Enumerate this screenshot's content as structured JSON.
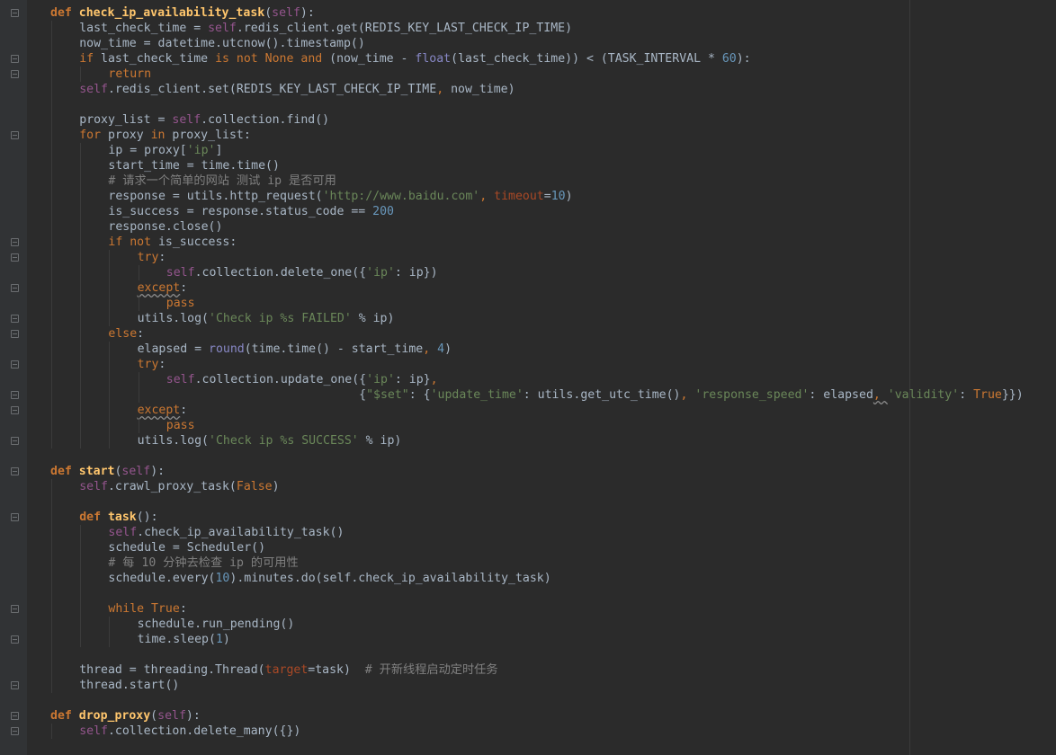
{
  "editor": {
    "theme_colors": {
      "background": "#2b2b2b",
      "keyword": "#cc7832",
      "function_name": "#ffc66d",
      "self": "#94558d",
      "string": "#6a8759",
      "number": "#6897bb",
      "comment": "#808080",
      "builtin": "#8888c6",
      "default_text": "#a9b7c6"
    },
    "lines": [
      {
        "fold": true,
        "indent": 0,
        "tokens": [
          [
            "kw",
            "def "
          ],
          [
            "fn",
            "check_ip_availability_task"
          ],
          [
            "op",
            "("
          ],
          [
            "self",
            "self"
          ],
          [
            "op",
            "):"
          ]
        ]
      },
      {
        "fold": false,
        "indent": 1,
        "tokens": [
          [
            "op",
            "last_check_time = "
          ],
          [
            "self",
            "self"
          ],
          [
            "op",
            ".redis_client.get(REDIS_KEY_LAST_CHECK_IP_TIME)"
          ]
        ]
      },
      {
        "fold": false,
        "indent": 1,
        "tokens": [
          [
            "op",
            "now_time = datetime.utcnow().timestamp()"
          ]
        ]
      },
      {
        "fold": true,
        "indent": 1,
        "tokens": [
          [
            "kwn",
            "if"
          ],
          [
            "op",
            " last_check_time "
          ],
          [
            "kwn",
            "is not"
          ],
          [
            "op",
            " "
          ],
          [
            "kwn",
            "None"
          ],
          [
            "op",
            " "
          ],
          [
            "kwn",
            "and"
          ],
          [
            "op",
            " (now_time - "
          ],
          [
            "bi",
            "float"
          ],
          [
            "op",
            "(last_check_time)) < (TASK_INTERVAL * "
          ],
          [
            "num",
            "60"
          ],
          [
            "op",
            "):"
          ]
        ]
      },
      {
        "fold": true,
        "indent": 2,
        "tokens": [
          [
            "kwn",
            "return"
          ]
        ]
      },
      {
        "fold": false,
        "indent": 1,
        "tokens": [
          [
            "self",
            "self"
          ],
          [
            "op",
            ".redis_client.set(REDIS_KEY_LAST_CHECK_IP_TIME"
          ],
          [
            "kwn",
            ","
          ],
          [
            "op",
            " now_time)"
          ]
        ]
      },
      {
        "fold": false,
        "indent": 1,
        "tokens": []
      },
      {
        "fold": false,
        "indent": 1,
        "tokens": [
          [
            "op",
            "proxy_list = "
          ],
          [
            "self",
            "self"
          ],
          [
            "op",
            ".collection.find()"
          ]
        ]
      },
      {
        "fold": true,
        "indent": 1,
        "tokens": [
          [
            "kwn",
            "for"
          ],
          [
            "op",
            " proxy "
          ],
          [
            "kwn",
            "in"
          ],
          [
            "op",
            " proxy_list:"
          ]
        ]
      },
      {
        "fold": false,
        "indent": 2,
        "tokens": [
          [
            "op",
            "ip = proxy["
          ],
          [
            "str",
            "'ip'"
          ],
          [
            "op",
            "]"
          ]
        ]
      },
      {
        "fold": false,
        "indent": 2,
        "tokens": [
          [
            "op",
            "start_time = time.time()"
          ]
        ]
      },
      {
        "fold": false,
        "indent": 2,
        "tokens": [
          [
            "cmt",
            "# 请求一个简单的网站 测试 ip 是否可用"
          ]
        ]
      },
      {
        "fold": false,
        "indent": 2,
        "tokens": [
          [
            "op",
            "response = utils.http_request("
          ],
          [
            "str",
            "'http://www.baidu.com'"
          ],
          [
            "kwn",
            ","
          ],
          [
            "op",
            " "
          ],
          [
            "param",
            "timeout"
          ],
          [
            "op",
            "="
          ],
          [
            "num",
            "10"
          ],
          [
            "op",
            ")"
          ]
        ]
      },
      {
        "fold": false,
        "indent": 2,
        "tokens": [
          [
            "op",
            "is_success = response.status_code == "
          ],
          [
            "num",
            "200"
          ]
        ]
      },
      {
        "fold": false,
        "indent": 2,
        "tokens": [
          [
            "op",
            "response.close()"
          ]
        ]
      },
      {
        "fold": true,
        "indent": 2,
        "tokens": [
          [
            "kwn",
            "if not"
          ],
          [
            "op",
            " is_success:"
          ]
        ]
      },
      {
        "fold": true,
        "indent": 3,
        "tokens": [
          [
            "kwn",
            "try"
          ],
          [
            "op",
            ":"
          ]
        ]
      },
      {
        "fold": false,
        "indent": 4,
        "tokens": [
          [
            "self",
            "self"
          ],
          [
            "op",
            ".collection.delete_one({"
          ],
          [
            "str",
            "'ip'"
          ],
          [
            "op",
            ": ip})"
          ]
        ]
      },
      {
        "fold": true,
        "indent": 3,
        "tokens": [
          [
            "kwn wavy",
            "except"
          ],
          [
            "op",
            ":"
          ]
        ]
      },
      {
        "fold": false,
        "indent": 4,
        "tokens": [
          [
            "kwn",
            "pass"
          ]
        ]
      },
      {
        "fold": true,
        "indent": 3,
        "tokens": [
          [
            "op",
            "utils.log("
          ],
          [
            "str",
            "'Check ip %s FAILED'"
          ],
          [
            "op",
            " % ip)"
          ]
        ]
      },
      {
        "fold": true,
        "indent": 2,
        "tokens": [
          [
            "kwn",
            "else"
          ],
          [
            "op",
            ":"
          ]
        ]
      },
      {
        "fold": false,
        "indent": 3,
        "tokens": [
          [
            "op",
            "elapsed = "
          ],
          [
            "bi",
            "round"
          ],
          [
            "op",
            "(time.time() - start_time"
          ],
          [
            "kwn",
            ","
          ],
          [
            "op",
            " "
          ],
          [
            "num",
            "4"
          ],
          [
            "op",
            ")"
          ]
        ]
      },
      {
        "fold": true,
        "indent": 3,
        "tokens": [
          [
            "kwn",
            "try"
          ],
          [
            "op",
            ":"
          ]
        ]
      },
      {
        "fold": false,
        "indent": 4,
        "tokens": [
          [
            "self",
            "self"
          ],
          [
            "op",
            ".collection.update_one({"
          ],
          [
            "str",
            "'ip'"
          ],
          [
            "op",
            ": ip}"
          ],
          [
            "kwn",
            ","
          ]
        ]
      },
      {
        "fold": true,
        "indent": 4,
        "tokens": [
          [
            "op",
            "                           {"
          ],
          [
            "str",
            "\"$set\""
          ],
          [
            "op",
            ": {"
          ],
          [
            "str",
            "'update_time'"
          ],
          [
            "op",
            ": utils.get_utc_time()"
          ],
          [
            "kwn",
            ","
          ],
          [
            "op",
            " "
          ],
          [
            "str",
            "'response_speed'"
          ],
          [
            "op",
            ": elapsed"
          ],
          [
            "kwn wavy",
            ", "
          ],
          [
            "str",
            "'validity'"
          ],
          [
            "op",
            ": "
          ],
          [
            "kwn",
            "True"
          ],
          [
            "op",
            "}})"
          ]
        ]
      },
      {
        "fold": true,
        "indent": 3,
        "tokens": [
          [
            "kwn wavy",
            "except"
          ],
          [
            "op",
            ":"
          ]
        ]
      },
      {
        "fold": false,
        "indent": 4,
        "tokens": [
          [
            "kwn",
            "pass"
          ]
        ]
      },
      {
        "fold": true,
        "indent": 3,
        "tokens": [
          [
            "op",
            "utils.log("
          ],
          [
            "str",
            "'Check ip %s SUCCESS'"
          ],
          [
            "op",
            " % ip)"
          ]
        ]
      },
      {
        "fold": false,
        "indent": 0,
        "tokens": []
      },
      {
        "fold": true,
        "indent": 0,
        "tokens": [
          [
            "kw",
            "def "
          ],
          [
            "fn",
            "start"
          ],
          [
            "op",
            "("
          ],
          [
            "self",
            "self"
          ],
          [
            "op",
            "):"
          ]
        ]
      },
      {
        "fold": false,
        "indent": 1,
        "tokens": [
          [
            "self",
            "self"
          ],
          [
            "op",
            ".crawl_proxy_task("
          ],
          [
            "kwn",
            "False"
          ],
          [
            "op",
            ")"
          ]
        ]
      },
      {
        "fold": false,
        "indent": 1,
        "tokens": []
      },
      {
        "fold": true,
        "indent": 1,
        "tokens": [
          [
            "kw",
            "def "
          ],
          [
            "fn",
            "task"
          ],
          [
            "op",
            "():"
          ]
        ]
      },
      {
        "fold": false,
        "indent": 2,
        "tokens": [
          [
            "self",
            "self"
          ],
          [
            "op",
            ".check_ip_availability_task()"
          ]
        ]
      },
      {
        "fold": false,
        "indent": 2,
        "tokens": [
          [
            "op",
            "schedule = Scheduler()"
          ]
        ]
      },
      {
        "fold": false,
        "indent": 2,
        "tokens": [
          [
            "cmt",
            "# 每 10 分钟去检查 ip 的可用性"
          ]
        ]
      },
      {
        "fold": false,
        "indent": 2,
        "tokens": [
          [
            "op",
            "schedule.every("
          ],
          [
            "num",
            "10"
          ],
          [
            "op",
            ").minutes.do(self.check_ip_availability_task)"
          ]
        ]
      },
      {
        "fold": false,
        "indent": 2,
        "tokens": []
      },
      {
        "fold": true,
        "indent": 2,
        "tokens": [
          [
            "kwn",
            "while"
          ],
          [
            "op",
            " "
          ],
          [
            "kwn",
            "True"
          ],
          [
            "op",
            ":"
          ]
        ]
      },
      {
        "fold": false,
        "indent": 3,
        "tokens": [
          [
            "op",
            "schedule.run_pending()"
          ]
        ]
      },
      {
        "fold": true,
        "indent": 3,
        "tokens": [
          [
            "op",
            "time.sleep("
          ],
          [
            "num",
            "1"
          ],
          [
            "op",
            ")"
          ]
        ]
      },
      {
        "fold": false,
        "indent": 1,
        "tokens": []
      },
      {
        "fold": false,
        "indent": 1,
        "tokens": [
          [
            "op",
            "thread = threading.Thread("
          ],
          [
            "param",
            "target"
          ],
          [
            "op",
            "=task)  "
          ],
          [
            "cmt",
            "# 开新线程启动定时任务"
          ]
        ]
      },
      {
        "fold": true,
        "indent": 1,
        "tokens": [
          [
            "op",
            "thread.start()"
          ]
        ]
      },
      {
        "fold": false,
        "indent": 0,
        "tokens": []
      },
      {
        "fold": true,
        "indent": 0,
        "tokens": [
          [
            "kw",
            "def "
          ],
          [
            "fn",
            "drop_proxy"
          ],
          [
            "op",
            "("
          ],
          [
            "self",
            "self"
          ],
          [
            "op",
            "):"
          ]
        ]
      },
      {
        "fold": true,
        "indent": 1,
        "tokens": [
          [
            "self",
            "self"
          ],
          [
            "op",
            ".collection.delete_many({})"
          ]
        ]
      }
    ]
  }
}
